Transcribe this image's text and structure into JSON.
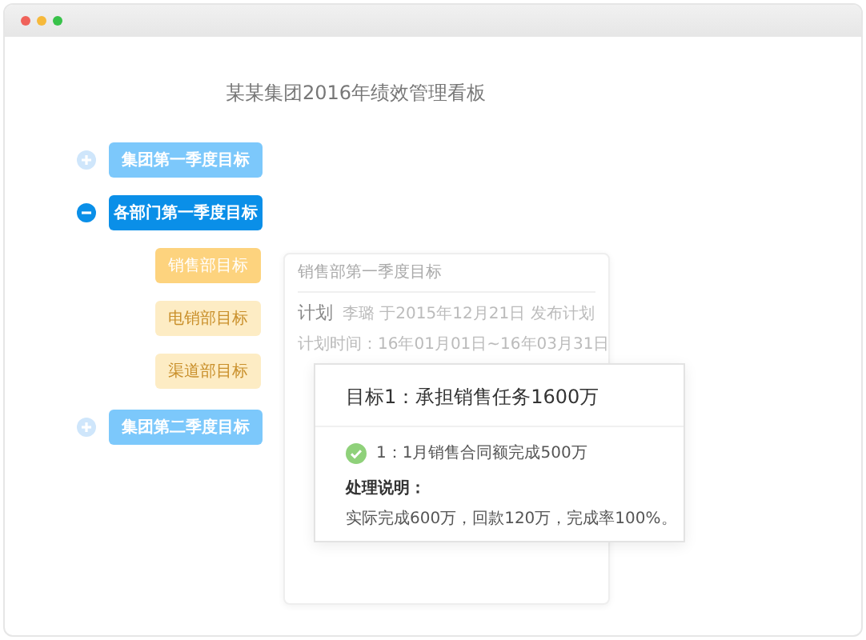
{
  "window": {
    "title": "某某集团2016年绩效管理看板"
  },
  "tree": [
    {
      "label": "集团第一季度目标",
      "expanded": false
    },
    {
      "label": "各部门第一季度目标",
      "expanded": true,
      "children": [
        {
          "label": "销售部目标",
          "selected": true
        },
        {
          "label": "电销部目标",
          "selected": false
        },
        {
          "label": "渠道部目标",
          "selected": false
        }
      ]
    },
    {
      "label": "集团第二季度目标",
      "expanded": false
    }
  ],
  "plan_card": {
    "title": "销售部第一季度目标",
    "heading": "计划",
    "publisher": "李璐 于2015年12月21日 发布计划",
    "period": "计划时间：16年01月01日~16年03月31日"
  },
  "goal_popup": {
    "title": "目标1：承担销售任务1600万",
    "tasks": [
      {
        "text": "1：1月销售合同额完成500万",
        "done": true
      }
    ],
    "note_label": "处理说明：",
    "note": "实际完成600万，回款120万，完成率100%。"
  }
}
